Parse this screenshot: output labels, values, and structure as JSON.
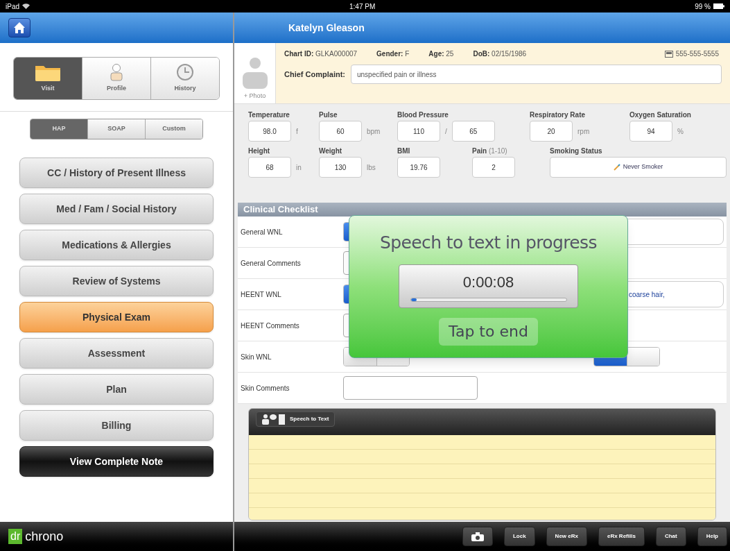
{
  "status_bar": {
    "device": "iPad",
    "time": "1:47 PM",
    "battery": "99 %"
  },
  "segments": [
    {
      "label": "Visit",
      "selected": true
    },
    {
      "label": "Profile",
      "selected": false
    },
    {
      "label": "History",
      "selected": false
    }
  ],
  "note_formats": [
    {
      "label": "HAP",
      "selected": true
    },
    {
      "label": "SOAP",
      "selected": false
    },
    {
      "label": "Custom",
      "selected": false
    }
  ],
  "sections": [
    {
      "label": "CC / History of Present Illness",
      "kind": "section",
      "selected": false
    },
    {
      "label": "Med / Fam / Social History",
      "kind": "section",
      "selected": false
    },
    {
      "label": "Medications & Allergies",
      "kind": "section",
      "selected": false
    },
    {
      "label": "Review of Systems",
      "kind": "section",
      "selected": false
    },
    {
      "label": "Physical Exam",
      "kind": "section",
      "selected": true
    },
    {
      "label": "Assessment",
      "kind": "section",
      "selected": false
    },
    {
      "label": "Plan",
      "kind": "section",
      "selected": false
    },
    {
      "label": "Billing",
      "kind": "section",
      "selected": false
    },
    {
      "label": "View Complete Note",
      "kind": "action"
    }
  ],
  "logo": {
    "prefix": "dr",
    "name": "chrono"
  },
  "patient": {
    "name": "Katelyn Gleason",
    "photo_label": "+ Photo",
    "fields": [
      {
        "label": "Chart ID:",
        "value": "GLKA000007"
      },
      {
        "label": "Gender:",
        "value": "F"
      },
      {
        "label": "Age:",
        "value": "25"
      },
      {
        "label": "DoB:",
        "value": "02/15/1986"
      }
    ],
    "phone": "555-555-5555",
    "chief_complaint_label": "Chief Complaint:",
    "chief_complaint": "unspecified pain or illness"
  },
  "vitals": [
    [
      {
        "label": "Temperature",
        "fields": [
          "98.0"
        ],
        "unit": "f"
      },
      {
        "label": "Pulse",
        "fields": [
          "60"
        ],
        "unit": "bpm"
      },
      {
        "label": "Blood Pressure",
        "fields": [
          "110",
          "65"
        ],
        "separator": "/"
      },
      {
        "label": "Respiratory Rate",
        "fields": [
          "20"
        ],
        "unit": "rpm"
      },
      {
        "label": "Oxygen Saturation",
        "fields": [
          "94"
        ],
        "unit": "%"
      }
    ],
    [
      {
        "label": "Height",
        "fields": [
          "68"
        ],
        "unit": "in"
      },
      {
        "label": "Weight",
        "fields": [
          "130"
        ],
        "unit": "lbs"
      },
      {
        "label": "BMI",
        "fields": [
          "19.76"
        ]
      },
      {
        "label": "Pain",
        "note": "(1-10)",
        "fields": [
          "2"
        ]
      },
      {
        "label": "Smoking Status",
        "kind": "select",
        "value": "Never Smoker"
      }
    ]
  ],
  "checklist": {
    "title": "Clinical Checklist",
    "rows": [
      {
        "label": "General WNL",
        "kind": "toggle",
        "on": true
      },
      {
        "label": "General Comments",
        "kind": "comment"
      },
      {
        "label": "HEENT WNL",
        "kind": "toggle",
        "on": true,
        "value": "coarse hair,"
      },
      {
        "label": "HEENT Comments",
        "kind": "comment"
      },
      {
        "label": "Skin WNL",
        "kind": "toggle",
        "on": false,
        "second_on": true
      },
      {
        "label": "Skin Comments",
        "kind": "comment"
      }
    ]
  },
  "speech_panel": {
    "title": "Speech to Text"
  },
  "overlay": {
    "title": "Speech to text in progress",
    "elapsed": "0:00:08",
    "level": 0.04,
    "button": "Tap to end"
  },
  "toolbar": [
    {
      "kind": "camera"
    },
    {
      "label": "Lock"
    },
    {
      "label": "New eRx"
    },
    {
      "label": "eRx Refills"
    },
    {
      "label": "Chat"
    },
    {
      "label": "Help"
    }
  ]
}
